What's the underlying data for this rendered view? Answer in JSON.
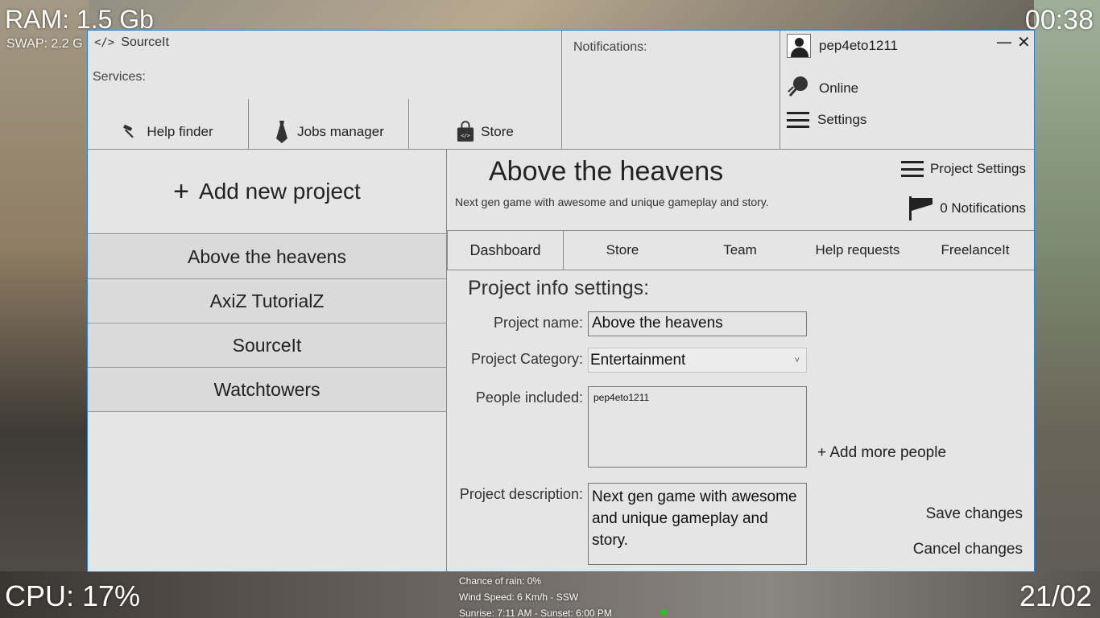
{
  "desktop": {
    "ram": "RAM: 1.5 Gb",
    "swap": "SWAP: 2.2 G",
    "time": "00:38",
    "cpu": "CPU: 17%",
    "date": "21/02",
    "weather": {
      "rain": "Chance of rain: 0%",
      "wind": "Wind Speed: 6 Km/h - SSW",
      "sun": "Sunrise: 7:11 AM - Sunset: 6:00 PM"
    }
  },
  "app": {
    "title": "SourceIt",
    "services_label": "Services:",
    "services": [
      {
        "label": "Help finder",
        "icon": "hammer-icon"
      },
      {
        "label": "Jobs manager",
        "icon": "tie-icon"
      },
      {
        "label": "Store",
        "icon": "store-bag-icon"
      }
    ],
    "notifications_label": "Notifications:",
    "user": {
      "name": "pep4eto1211",
      "status": "Online",
      "settings": "Settings"
    },
    "window": {
      "minimize": "—",
      "close": "✕"
    }
  },
  "projects": {
    "add_label": "Add new project",
    "items": [
      "Above the heavens",
      "AxiZ TutorialZ",
      "SourceIt",
      "Watchtowers"
    ]
  },
  "project": {
    "title": "Above the heavens",
    "description": "Next gen game with awesome and unique gameplay and story.",
    "settings_action": "Project Settings",
    "notifications_action": "0 Notifications",
    "tabs": [
      "Dashboard",
      "Store",
      "Team",
      "Help requests",
      "FreelanceIt"
    ],
    "form": {
      "title": "Project info settings:",
      "name_label": "Project name:",
      "name_value": "Above the heavens",
      "category_label": "Project Category:",
      "category_value": "Entertainment",
      "people_label": "People included:",
      "people_value": "pep4eto1211",
      "add_people": "+ Add more people",
      "description_label": "Project description:",
      "description_value": "Next gen game with awesome and unique gameplay and story.",
      "save": "Save changes",
      "cancel": "Cancel changes"
    }
  }
}
